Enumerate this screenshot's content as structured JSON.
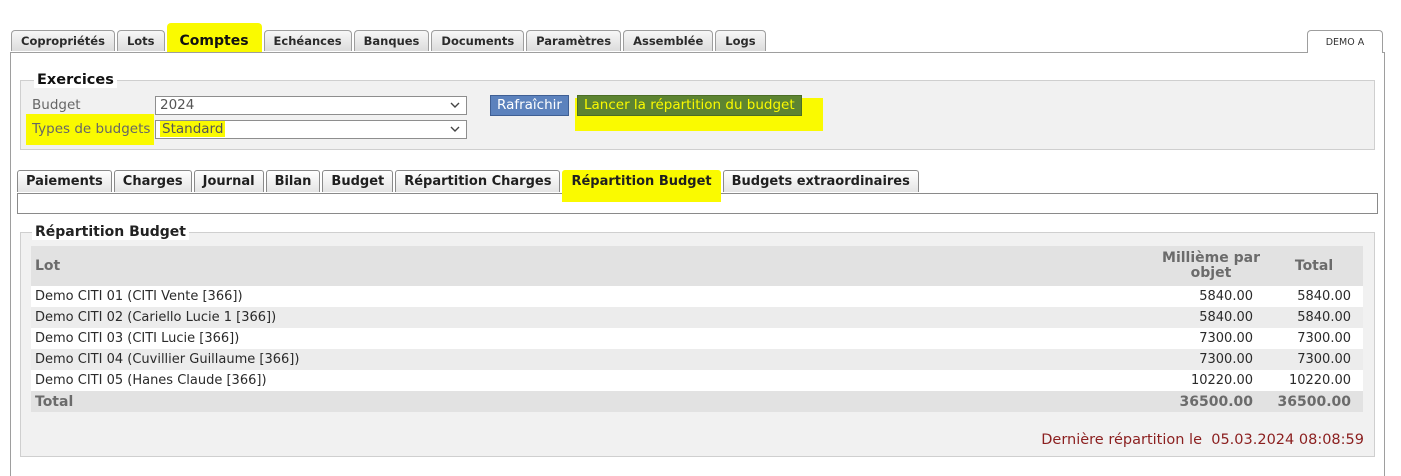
{
  "top_tabs": [
    "Copropriétés",
    "Lots",
    "Comptes",
    "Echéances",
    "Banques",
    "Documents",
    "Paramètres",
    "Assemblée",
    "Logs"
  ],
  "top_tabs_active": 2,
  "user_tab": "DEMO A",
  "exercices": {
    "legend": "Exercices",
    "budget_label": "Budget",
    "budget_value": "2024",
    "types_label": "Types de budgets",
    "types_value": "Standard",
    "refresh_button": "Rafraîchir",
    "launch_button": "Lancer la répartition du budget"
  },
  "sub_tabs": [
    "Paiements",
    "Charges",
    "Journal",
    "Bilan",
    "Budget",
    "Répartition Charges",
    "Répartition Budget",
    "Budgets extraordinaires"
  ],
  "sub_tabs_active": 6,
  "repartition": {
    "legend": "Répartition Budget",
    "columns": {
      "lot": "Lot",
      "millieme": "Millième par objet",
      "total": "Total"
    },
    "rows": [
      {
        "lot": "Demo CITI 01 (CITI Vente [366])",
        "millieme": "5840.00",
        "total": "5840.00"
      },
      {
        "lot": "Demo CITI 02 (Cariello Lucie 1 [366])",
        "millieme": "5840.00",
        "total": "5840.00"
      },
      {
        "lot": "Demo CITI 03 (CITI Lucie [366])",
        "millieme": "7300.00",
        "total": "7300.00"
      },
      {
        "lot": "Demo CITI 04 (Cuvillier Guillaume [366])",
        "millieme": "7300.00",
        "total": "7300.00"
      },
      {
        "lot": "Demo CITI 05 (Hanes Claude [366])",
        "millieme": "10220.00",
        "total": "10220.00"
      }
    ],
    "total_row": {
      "label": "Total",
      "millieme": "36500.00",
      "total": "36500.00"
    },
    "last_repartition_label": "Dernière répartition le",
    "last_repartition_date": "05.03.2024 08:08:59"
  },
  "colors": {
    "highlight": "#fafa00",
    "button_blue": "#5c82bd",
    "date_red": "#8b1f1f"
  }
}
